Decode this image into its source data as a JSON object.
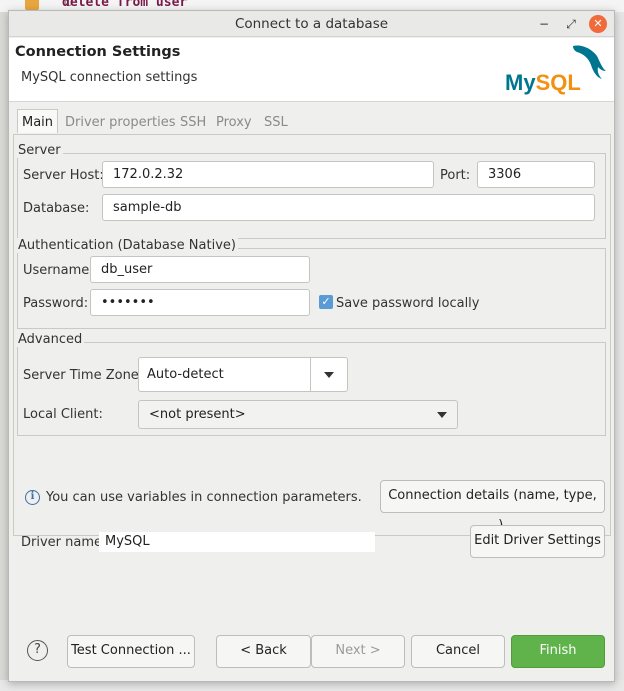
{
  "background": {
    "code_text": "delete from user"
  },
  "window": {
    "title": "Connect to a database",
    "controls": {
      "minimize": "−",
      "maximize": "⤢",
      "close": "✕"
    }
  },
  "header": {
    "title": "Connection Settings",
    "subtitle": "MySQL connection settings",
    "logo_text": "MySQL"
  },
  "tabs": [
    {
      "label": "Main",
      "active": true
    },
    {
      "label": "Driver properties",
      "active": false
    },
    {
      "label": "SSH",
      "active": false
    },
    {
      "label": "Proxy",
      "active": false
    },
    {
      "label": "SSL",
      "active": false
    }
  ],
  "server": {
    "legend": "Server",
    "host_label": "Server Host:",
    "host_value": "172.0.2.32",
    "port_label": "Port:",
    "port_value": "3306",
    "database_label": "Database:",
    "database_value": "sample-db"
  },
  "auth": {
    "legend": "Authentication (Database Native)",
    "username_label": "Username:",
    "username_value": "db_user",
    "password_label": "Password:",
    "password_value": "•••••••",
    "save_password_label": "Save password locally",
    "save_password_checked": true
  },
  "advanced": {
    "legend": "Advanced",
    "timezone_label": "Server Time Zone:",
    "timezone_value": "Auto-detect",
    "local_client_label": "Local Client:",
    "local_client_value": "<not present>"
  },
  "info": {
    "text": "You can use variables in connection parameters.",
    "connection_details_button": "Connection details (name, type, ... )"
  },
  "driver": {
    "label": "Driver name:",
    "value": "MySQL",
    "edit_button": "Edit Driver Settings"
  },
  "footer": {
    "help": "?",
    "test_connection": "Test Connection ...",
    "back": "< Back",
    "next": "Next >",
    "cancel": "Cancel",
    "finish": "Finish"
  },
  "colors": {
    "finish_green": "#5fb34a",
    "checkbox_blue": "#5a9ad5",
    "close_orange": "#f06a3a",
    "mysql_blue": "#00758f",
    "mysql_orange": "#f29111"
  }
}
